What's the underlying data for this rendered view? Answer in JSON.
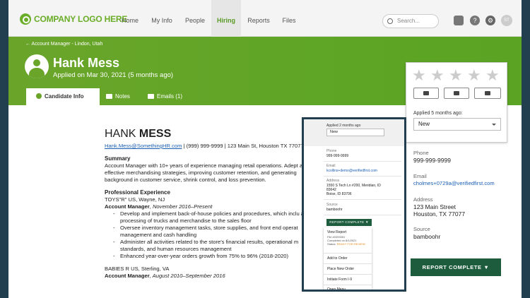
{
  "nav": {
    "logo_text": "COMPANY LOGO HERE",
    "items": [
      "Home",
      "My Info",
      "People",
      "Hiring",
      "Reports",
      "Files"
    ],
    "active": "Hiring",
    "search_placeholder": "Search...",
    "avatar_initials": "ST"
  },
  "header": {
    "breadcrumb": "← Account Manager - Lindon, Utah",
    "name": "Hank Mess",
    "applied": "Applied on Mar 30, 2021 (5 months ago)",
    "tabs": [
      "Candidate Info",
      "Notes",
      "Emails (1)"
    ]
  },
  "resume": {
    "first": "HANK ",
    "last": "MESS",
    "email": "Hank.Mess@SomethingHR.com",
    "contact_rest": " | (999) 999-9999 | 123 Main St, Houston TX 77077",
    "summary_title": "Summary",
    "summary": "Account Manager with 10+ years of experience managing retail operations. Adept at effective merchandising strategies, improving customer retention, and generating background in customer service, shrink control, and loss prevention.",
    "exp_title": "Professional Experience",
    "job1_company": "TOYS\"R\" US, Wayne, NJ",
    "job1_title": "Account Manager",
    "job1_dates": ", November 2016–Present",
    "job1_bullets": [
      "Develop and implement back-of-house policies and procedures, which inclu and processing of trucks and merchandise to the sales floor",
      "Oversee inventory management tasks, store supplies, and front end operat management and cash handling",
      "Administer all activities related to the store's financial results, operational m standards, and human resources management",
      "Enhanced year-over-year orders growth from 75% to 96%  (2018-2020)"
    ],
    "job2_company": "BABIES R US, Sterling, VA",
    "job2_title": "Account Manager",
    "job2_dates": ", August 2010–September 2016"
  },
  "card": {
    "stars": 5,
    "applied_label": "Applied 5 months ago:",
    "status": "New"
  },
  "details": {
    "phone_label": "Phone",
    "phone": "999-999-9999",
    "email_label": "Email",
    "email": "cholmes+0729a@verifiedfirst.com",
    "address_label": "Address",
    "address1": "123 Main Street",
    "address2": "Houston, TX 77077",
    "source_label": "Source",
    "source": "bamboohr",
    "report_button": "REPORT COMPLETE ▼"
  },
  "overlay": {
    "applied": "Applied 2 months ago",
    "status": "New",
    "phone_label": "Phone",
    "phone": "999-999-9999",
    "email_label": "Email",
    "email": "kcollins+demo@verifiedfirst.com",
    "address_label": "Address",
    "address1": "1550 S Tech Ln #200, Meridian, ID",
    "address2": "83642",
    "address3": "Boise, ID 83706",
    "source_label": "Source",
    "source": "bamboohr",
    "report_button": "REPORT COMPLETE ▼",
    "menu": {
      "view_report": "View Report",
      "file": "File #0399351",
      "completed": "Completed on 8/1/2021",
      "status_prefix": "Status: ",
      "status_value": "READY FOR REVIEW",
      "add_order": "Add to Order",
      "new_order": "Place New Order",
      "i9": "Initiate Form I-9",
      "open_menu": "Open Menu"
    }
  }
}
